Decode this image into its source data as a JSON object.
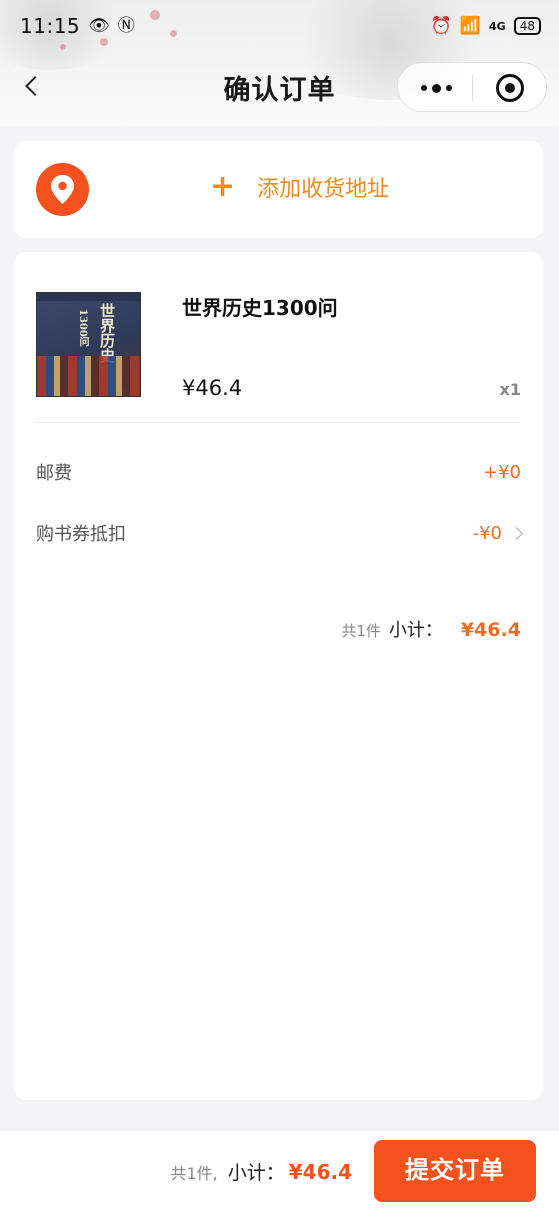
{
  "status_bar": {
    "time": "11:15",
    "network": "4G",
    "battery": "48"
  },
  "navbar": {
    "title": "确认订单"
  },
  "address": {
    "add_label": "添加收货地址",
    "plus_symbol": "+"
  },
  "item": {
    "name": "世界历史1300问",
    "price": "¥46.4",
    "quantity": "x1",
    "cover_title": "世界历史",
    "cover_sub": "1300问"
  },
  "fees": [
    {
      "label": "邮费",
      "value": "+¥0"
    },
    {
      "label": "购书券抵扣",
      "value": "-¥0"
    }
  ],
  "subtotal": {
    "count": "共1件",
    "label": "小计：",
    "amount": "¥46.4"
  },
  "footer": {
    "count": "共1件,",
    "label": "小计：",
    "amount": "¥46.4",
    "submit_label": "提交订单"
  },
  "colors": {
    "accent": "#f4511e",
    "price_orange": "#ef6b22",
    "address_orange": "#ef8a1e"
  }
}
